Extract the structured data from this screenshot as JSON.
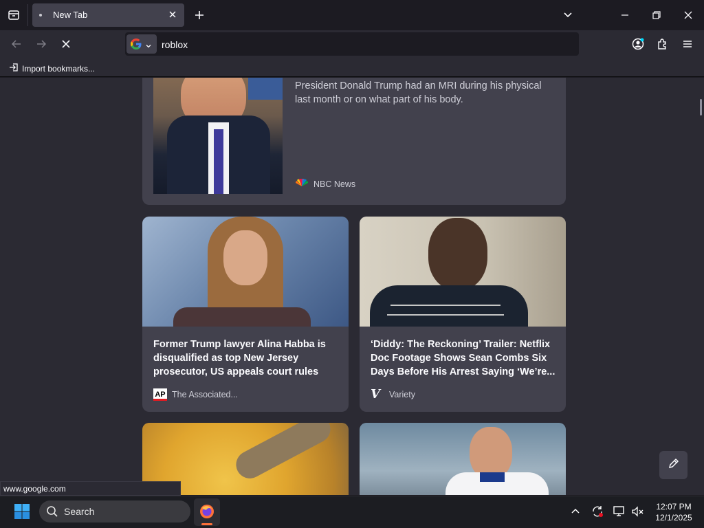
{
  "browser": {
    "tab_title": "New Tab",
    "url_text": "roblox",
    "bookmark_import_label": "Import bookmarks...",
    "status_link": "www.google.com",
    "accent": "#00ddff"
  },
  "feed": {
    "top_card": {
      "snippet_line1": "President Donald Trump had an MRI during his physical",
      "snippet_line2": "last month or on what part of his body.",
      "source": "NBC News"
    },
    "cards": [
      {
        "headline": "Former Trump lawyer Alina Habba is disqualified as top New Jersey prosecutor, US appeals court rules",
        "source": "The Associated..."
      },
      {
        "headline": "‘Diddy: The Reckoning’ Trailer: Netflix Doc Footage Shows Sean Combs Six Days Before His Arrest Saying ‘We’re...",
        "source": "Variety"
      }
    ]
  },
  "taskbar": {
    "search_label": "Search",
    "time": "12:07 PM",
    "date": "12/1/2025"
  }
}
